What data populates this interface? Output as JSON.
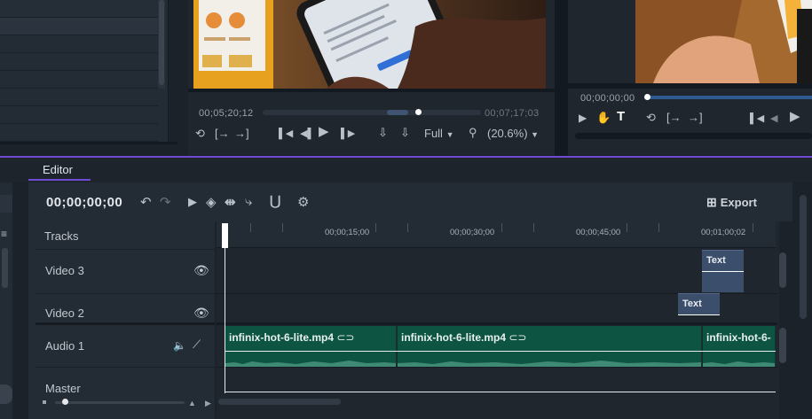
{
  "source_viewer": {
    "current_time": "00;05;20;12",
    "duration": "00;07;17;03",
    "quality": "Full",
    "zoom": "(20.6%)",
    "progress": 0.72,
    "icons": [
      "loop-icon",
      "mark-in-icon",
      "mark-out-icon",
      "step-back-icon",
      "prev-frame-icon",
      "play-icon",
      "next-frame-icon",
      "insert-icon",
      "overwrite-icon",
      "zoom-icon"
    ]
  },
  "program_viewer": {
    "current_time": "00;00;00;00",
    "progress": 0.0
  },
  "editor": {
    "tab_label": "Editor",
    "timecode": "00;00;00;00",
    "export_label": "Export",
    "tracks_label": "Tracks",
    "ruler_labels": [
      "00;00;15;00",
      "00;00;30;00",
      "00;00;45;00",
      "00;01;00;02"
    ],
    "tracks": [
      {
        "label": "Video 3"
      },
      {
        "label": "Video 2"
      },
      {
        "label": "Audio 1"
      },
      {
        "label": "Master"
      }
    ],
    "text_clips": [
      {
        "label": "Text",
        "track": "Video 3"
      },
      {
        "label": "Text",
        "track": "Video 2"
      }
    ],
    "audio_clips": [
      {
        "label": "infinix-hot-6-lite.mp4"
      },
      {
        "label": "infinix-hot-6-lite.mp4"
      },
      {
        "label": "infinix-hot-6-"
      }
    ]
  },
  "colors": {
    "accent": "#6f4bd3",
    "audio_clip": "#0e5443",
    "text_clip": "#3b4e6c",
    "background": "#1b2229"
  }
}
